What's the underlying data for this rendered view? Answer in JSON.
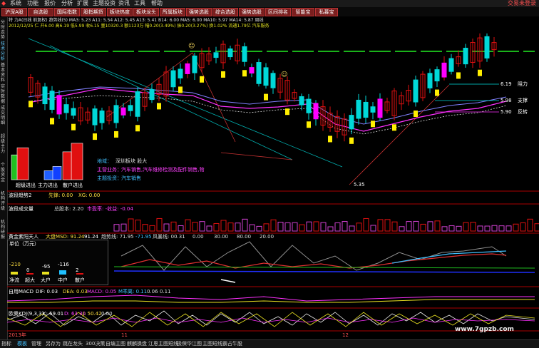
{
  "menu": {
    "items": [
      "系统",
      "功能",
      "报价",
      "分析",
      "扩展",
      "主题投资",
      "资讯",
      "工具",
      "帮助"
    ],
    "login": "交易未登录"
  },
  "toolbar": {
    "buttons": [
      "沪深A股",
      "自选股",
      "国际指数",
      "股指期货",
      "板块热度",
      "板块龙头",
      "所属板块",
      "强势选股",
      "综合选股",
      "强势选股",
      "区间排名",
      "智能宝",
      "私募宝"
    ]
  },
  "left_tabs": [
    "分时走势",
    "技术分析",
    "基本资料",
    "实时数据",
    "成交明细",
    "超级主力",
    "个股资金",
    "机构评级",
    "机构研报"
  ],
  "header": {
    "line1": "特 力A(日线 前复权) 趋势线(5)  MA3: 5.23  A11: 5.54  A12: 5.45  A13: 5.41  B14: 6.00  MA5: 6.00  MA10: 5.97  MA14: 5.87  周线",
    "line2": "2012/12/25 仁 开6.00 高6.19 低5.99 收6.15 量10320.3 额1123万 幅0.20(3.49%) 振0.20(3.27%) 换1.02% 流通1.79亿  汽车服务"
  },
  "price_labels": {
    "resist_label": "阻力",
    "resist_value": "6.19",
    "support_label": "支撑",
    "support_value": "5.98",
    "reverse_label": "反转",
    "reverse_value": "5.90",
    "low_value": "5.35"
  },
  "mini_bars": {
    "labels": [
      "超级进出",
      "主力进出",
      "散户进出"
    ],
    "values": [
      64,
      18,
      73
    ],
    "colors": [
      "#e01010",
      "#2060ff",
      "#e01010"
    ]
  },
  "left_vtext": [
    "超级主力",
    "个股资金",
    "资金流向"
  ],
  "info_box": {
    "row1_label": "地域：",
    "row1_value": "深圳板块 股大",
    "row2_label": "主营业务：",
    "row2_value": "汽车销售,汽车维修检测及配件销售,物",
    "row3_label": "主题投资：",
    "row3_value": "汽车销售"
  },
  "indicators": {
    "panel1": {
      "title": "波段趋势2",
      "items": [
        "先锋: 0.00",
        "XG: 0.00"
      ]
    },
    "panel2": {
      "title": "波段成交量",
      "items": [
        "总股本: 2.20",
        "市盈率: -收益: -0.04"
      ]
    },
    "panel3": {
      "title": "黄金紫阳天人",
      "items": [
        "大盘MSD: 91.24",
        "91.24",
        "趋势线: 71.95",
        "-71.95",
        "风暴线: 00.31",
        "0.00",
        "30.00",
        "80.00",
        "20.00"
      ]
    },
    "panel4": {
      "title": "自用MACD",
      "items": [
        "DIF: 0.03",
        "DEA: 0.03",
        "MACD: 0.05",
        "M乖离: 0.11",
        "0.06",
        "0.11"
      ]
    },
    "panel5": {
      "title": "欧奥KDJ(9,3,3)",
      "items": [
        "K: 59.01",
        "D: 63.30",
        "J: 50.42",
        "0.00"
      ]
    }
  },
  "unit_box": {
    "title": "单位（万元）",
    "labels": [
      "净流",
      "超大",
      "大户",
      "中户",
      "散户"
    ],
    "values": [
      "-210",
      "0",
      "-95",
      "-116",
      "2"
    ]
  },
  "x_axis": {
    "year_left": "2013年",
    "marks": [
      "11",
      "12"
    ]
  },
  "status": {
    "items": [
      "指标",
      "模板",
      "管理",
      "另存为",
      "跳在龙头",
      "300决策",
      "自编主图",
      "麒麟换盘",
      "江恩主图短线",
      "极保华江图",
      "主图短线",
      "霸占牛股"
    ]
  },
  "watermark": "www.7gpzb.com",
  "colors": {
    "up": "#e01010",
    "down": "#00d8d8",
    "yellow": "#ffee00",
    "magenta": "#ff00ff",
    "green": "#22ee22",
    "panel_border": "#aa0000"
  }
}
